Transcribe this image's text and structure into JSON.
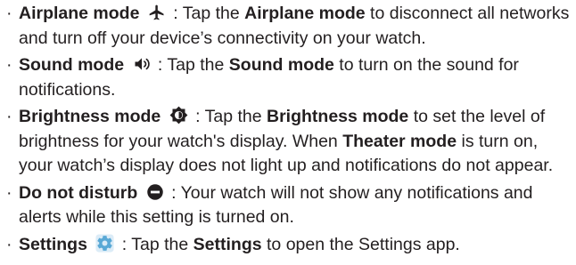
{
  "items": [
    {
      "bullet": "·",
      "term": "Airplane mode",
      "icon": "airplane-icon",
      "colon": " : ",
      "seg1": "Tap the ",
      "strong1": "Airplane mode",
      "seg2": " to disconnect all networks and turn off your device’s connectivity on your watch."
    },
    {
      "bullet": "·",
      "term": "Sound mode",
      "icon": "speaker-icon",
      "colon": " : ",
      "seg1": "Tap the ",
      "strong1": "Sound mode",
      "seg2": " to turn on the sound for notifications."
    },
    {
      "bullet": "·",
      "term": "Brightness mode",
      "icon": "brightness-icon",
      "colon": " : ",
      "seg1": "Tap the ",
      "strong1": "Brightness mode",
      "seg2": " to set the level of brightness for your watch's display. When ",
      "strong2": "Theater mode",
      "seg3": " is turn on, your watch’s display does not light up and notifications do not appear."
    },
    {
      "bullet": "·",
      "term": "Do not disturb",
      "icon": "do-not-disturb-icon",
      "colon": " : ",
      "seg1": "Your watch will not show any notifications and alerts while this setting is turned on."
    },
    {
      "bullet": "·",
      "term": "Settings",
      "icon": "settings-gear-icon",
      "colon": " : ",
      "seg1": "Tap the ",
      "strong1": "Settings",
      "seg2": " to open the Settings app."
    }
  ],
  "colors": {
    "text": "#231f20",
    "settings_icon": "#5aa9d6"
  }
}
